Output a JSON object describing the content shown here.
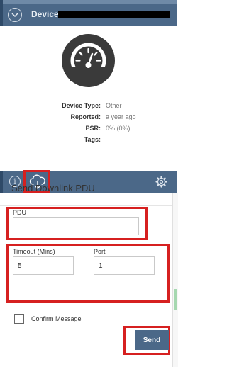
{
  "header": {
    "title": "Device",
    "chevron_icon": "chevron-down-icon"
  },
  "device": {
    "icon": "gauge-icon",
    "info": [
      {
        "label": "Device Type:",
        "value": "Other"
      },
      {
        "label": "Reported:",
        "value": "a year ago"
      },
      {
        "label": "PSR:",
        "value": "0% (0%)"
      },
      {
        "label": "Tags:",
        "value": ""
      }
    ]
  },
  "toolbar": {
    "info_icon": "info-icon",
    "downlink_icon": "cloud-download-icon",
    "settings_icon": "gear-icon",
    "info_glyph": "i"
  },
  "form": {
    "title": "Send Downlink PDU",
    "pdu_label": "PDU",
    "pdu_value": "",
    "timeout_label": "Timeout (Mins)",
    "timeout_value": "5",
    "port_label": "Port",
    "port_value": "1",
    "confirm_label": "Confirm Message",
    "confirm_checked": false,
    "send_label": "Send"
  },
  "colors": {
    "header_bg": "#4b6888",
    "accent_red": "#d62020",
    "button_bg": "#4b6888"
  }
}
